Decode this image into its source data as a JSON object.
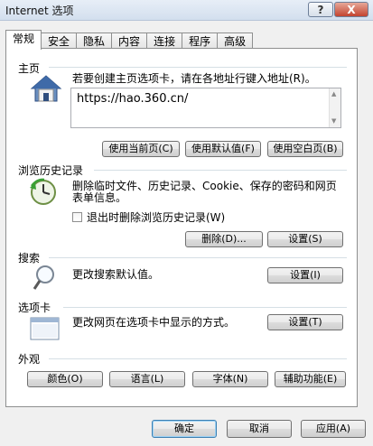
{
  "window": {
    "title": "Internet 选项",
    "help_label": "?",
    "close_label": "X"
  },
  "tabs": [
    "常规",
    "安全",
    "隐私",
    "内容",
    "连接",
    "程序",
    "高级"
  ],
  "home": {
    "title": "主页",
    "description": "若要创建主页选项卡，请在各地址行键入地址(R)。",
    "address": "https://hao.360.cn/",
    "buttons": {
      "use_current": "使用当前页(C)",
      "use_default": "使用默认值(F)",
      "use_blank": "使用空白页(B)"
    }
  },
  "history": {
    "title": "浏览历史记录",
    "description_line1": "删除临时文件、历史记录、Cookie、保存的密码和网页",
    "description_line2": "表单信息。",
    "checkbox_label": "退出时删除浏览历史记录(W)",
    "checkbox_checked": false,
    "delete_button": "删除(D)...",
    "settings_button": "设置(S)"
  },
  "search": {
    "title": "搜索",
    "description": "更改搜索默认值。",
    "settings_button": "设置(I)"
  },
  "tabs_section": {
    "title": "选项卡",
    "description": "更改网页在选项卡中显示的方式。",
    "settings_button": "设置(T)"
  },
  "appearance": {
    "title": "外观",
    "buttons": {
      "colors": "颜色(O)",
      "languages": "语言(L)",
      "fonts": "字体(N)",
      "accessibility": "辅助功能(E)"
    }
  },
  "footer": {
    "ok": "确定",
    "cancel": "取消",
    "apply": "应用(A)"
  },
  "icons": {
    "home": "house-icon",
    "history": "clock-refresh-icon",
    "search": "magnifier-icon",
    "tabs": "tab-window-icon"
  }
}
